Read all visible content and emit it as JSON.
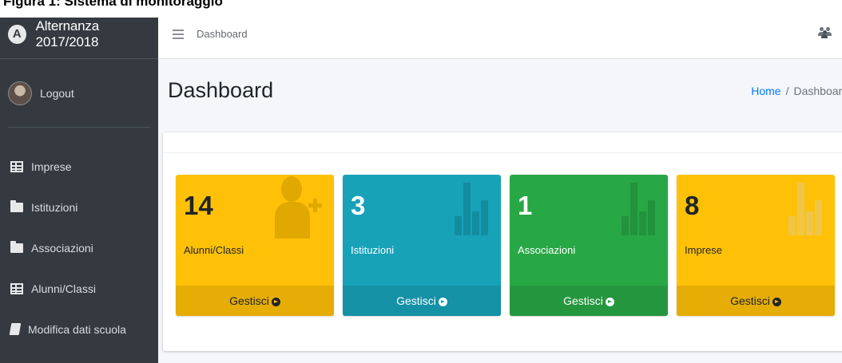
{
  "caption": "Figura 1: Sistema di monitoraggio",
  "colors": {
    "sidebar_bg": "#343a40",
    "content_bg": "#f4f6f9",
    "yellow": "#ffc107",
    "teal": "#17a2b8",
    "green": "#28a745",
    "link_blue": "#007bff"
  },
  "sidebar": {
    "brand": {
      "logo_letter": "A",
      "title": "Alternanza 2017/2018"
    },
    "user": {
      "logout_label": "Logout"
    },
    "items": [
      {
        "label": "Imprese",
        "icon": "table-icon"
      },
      {
        "label": "Istituzioni",
        "icon": "folder-icon"
      },
      {
        "label": "Associazioni",
        "icon": "folder-icon"
      },
      {
        "label": "Alunni/Classi",
        "icon": "table-icon"
      },
      {
        "label": "Modifica dati scuola",
        "icon": "book-icon"
      }
    ]
  },
  "topbar": {
    "menu_icon": "hamburger-icon",
    "link": "Dashboard",
    "right_icon": "users-icon"
  },
  "header": {
    "title": "Dashboard"
  },
  "breadcrumb": {
    "home": "Home",
    "separator": "/",
    "current": "Dashboard"
  },
  "boxes": [
    {
      "value": "14",
      "label": "Alunni/Classi",
      "footer": "Gestisci",
      "icon": "user-plus-icon",
      "color": "#ffc107"
    },
    {
      "value": "3",
      "label": "Istituzioni",
      "footer": "Gestisci",
      "icon": "bar-chart-icon",
      "color": "#17a2b8"
    },
    {
      "value": "1",
      "label": "Associazioni",
      "footer": "Gestisci",
      "icon": "bar-chart-icon",
      "color": "#28a745"
    },
    {
      "value": "8",
      "label": "Imprese",
      "footer": "Gestisci",
      "icon": "bar-chart-icon",
      "color": "#ffc107"
    }
  ]
}
